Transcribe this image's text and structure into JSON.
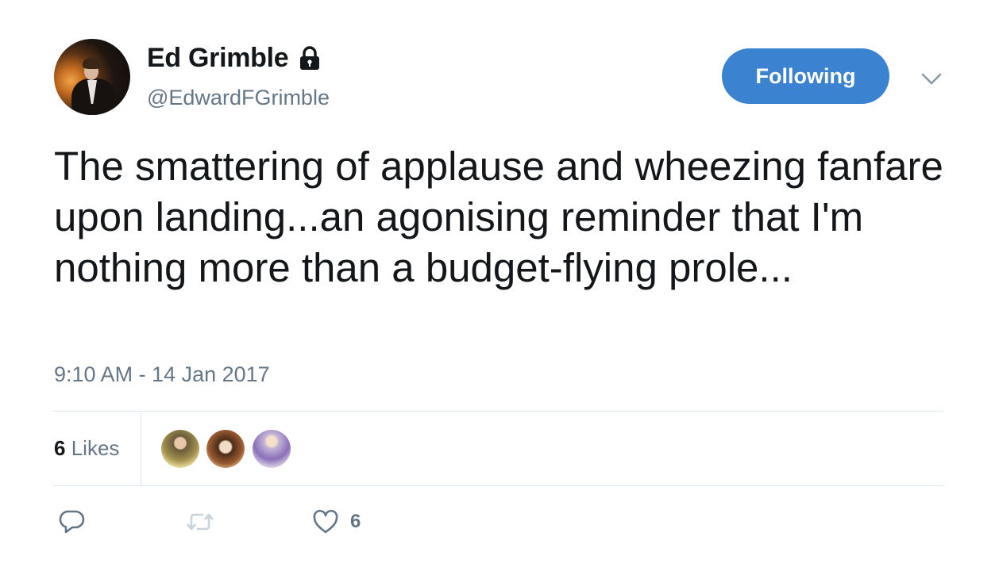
{
  "user": {
    "display_name": "Ed Grimble",
    "handle": "@EdwardFGrimble",
    "protected_icon": "lock-icon"
  },
  "follow_button": {
    "label": "Following",
    "color": "#3b82d0"
  },
  "menu_icon": "chevron-down-icon",
  "tweet": {
    "text": "The smattering of applause and wheezing fanfare upon landing...an agonising reminder that I'm nothing more than a budget-flying prole...",
    "timestamp": "9:10 AM - 14 Jan 2017"
  },
  "stats": {
    "likes_count": "6",
    "likes_label": "Likes",
    "likers": [
      "avatar",
      "avatar",
      "avatar"
    ]
  },
  "actions": {
    "reply_icon": "reply-icon",
    "retweet_icon": "retweet-icon",
    "like_icon": "heart-icon",
    "like_count": "6"
  },
  "colors": {
    "text": "#14171a",
    "secondary": "#657786",
    "divider": "#e1e8ed"
  }
}
